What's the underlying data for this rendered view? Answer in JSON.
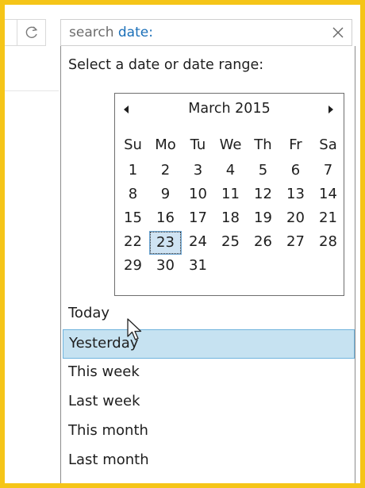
{
  "search": {
    "prefix": "search ",
    "keyword": "date:"
  },
  "dropdown": {
    "prompt": "Select a date or date range:"
  },
  "calendar": {
    "title": "March 2015",
    "weekdays": [
      "Su",
      "Mo",
      "Tu",
      "We",
      "Th",
      "Fr",
      "Sa"
    ],
    "weeks": [
      [
        "",
        "",
        "",
        "",
        "",
        "",
        ""
      ],
      [
        "1",
        "2",
        "3",
        "4",
        "5",
        "6",
        "7"
      ],
      [
        "8",
        "9",
        "10",
        "11",
        "12",
        "13",
        "14"
      ],
      [
        "15",
        "16",
        "17",
        "18",
        "19",
        "20",
        "21"
      ],
      [
        "22",
        "23",
        "24",
        "25",
        "26",
        "27",
        "28"
      ],
      [
        "29",
        "30",
        "31",
        "",
        "",
        "",
        ""
      ]
    ],
    "selected_day": "23"
  },
  "presets": [
    "Today",
    "Yesterday",
    "This week",
    "Last week",
    "This month",
    "Last month"
  ],
  "hovered_preset": "Yesterday",
  "colors": {
    "frame": "#f5c518",
    "keyword": "#1a6fb8",
    "hover_bg": "#c6e2f1",
    "hover_border": "#6fb3dd"
  },
  "icons": {
    "refresh": "refresh-icon",
    "close": "close-icon",
    "prev": "prev-month-icon",
    "next": "next-month-icon",
    "cursor": "mouse-pointer-icon"
  }
}
